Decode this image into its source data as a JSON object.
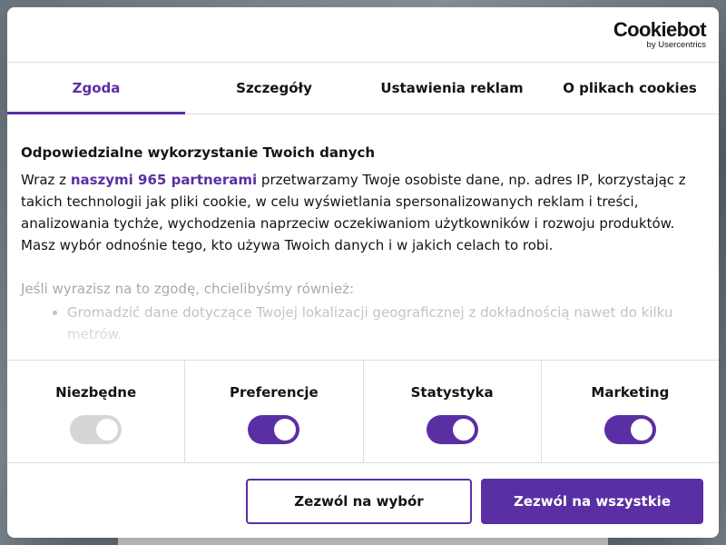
{
  "logo": {
    "main": "Cookiebot",
    "sub": "by Usercentrics"
  },
  "tabs": [
    {
      "label": "Zgoda",
      "active": true
    },
    {
      "label": "Szczegóły",
      "active": false
    },
    {
      "label": "Ustawienia reklam",
      "active": false
    },
    {
      "label": "O plikach cookies",
      "active": false
    }
  ],
  "content": {
    "heading": "Odpowiedzialne wykorzystanie Twoich danych",
    "intro_prefix": "Wraz z ",
    "partners_link": "naszymi 965 partnerami",
    "intro_rest": " przetwarzamy Twoje osobiste dane, np. adres IP, korzystając z takich technologii jak pliki cookie, w celu wyświetlania spersonalizowanych reklam i treści, analizowania tychże, wychodzenia naprzeciw oczekiwaniom użytkowników i rozwoju produktów. Masz wybór odnośnie tego, kto używa Twoich danych i w jakich celach to robi.",
    "sub_text": "Jeśli wyrazisz na to zgodę, chcielibyśmy również:",
    "bullets": [
      "Gromadzić dane dotyczące Twojej lokalizacji geograficznej z dokładnością nawet do kilku metrów."
    ]
  },
  "toggles": [
    {
      "label": "Niezbędne",
      "checked": true,
      "disabled": true
    },
    {
      "label": "Preferencje",
      "checked": true,
      "disabled": false
    },
    {
      "label": "Statystyka",
      "checked": true,
      "disabled": false
    },
    {
      "label": "Marketing",
      "checked": true,
      "disabled": false
    }
  ],
  "buttons": {
    "allow_selection": "Zezwól na wybór",
    "allow_all": "Zezwól na wszystkie"
  },
  "colors": {
    "accent": "#5b2fa4",
    "text": "#141414",
    "toggle_disabled": "#d6d6d6",
    "divider": "#dedede"
  }
}
